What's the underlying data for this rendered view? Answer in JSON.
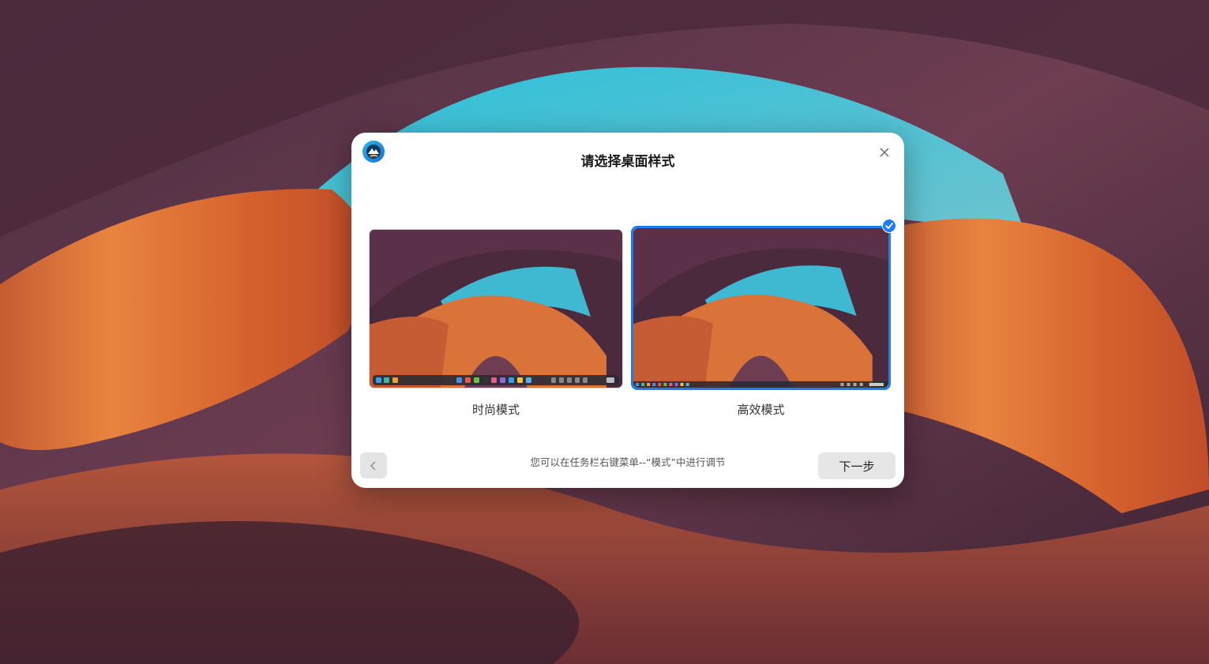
{
  "dialog": {
    "title": "请选择桌面样式",
    "close_icon": "close-icon",
    "logo_icon": "deepin-logo-icon"
  },
  "options": [
    {
      "label": "时尚模式",
      "selected": false
    },
    {
      "label": "高效模式",
      "selected": true
    }
  ],
  "footer": {
    "hint": "您可以在任务栏右键菜单--“模式”中进行调节",
    "next_label": "下一步",
    "back_icon": "chevron-left-icon"
  },
  "colors": {
    "accent": "#1f7cf0",
    "sky": "#3fb8d2",
    "rock_orange": "#d9733a",
    "rock_purple": "#5a3148"
  }
}
